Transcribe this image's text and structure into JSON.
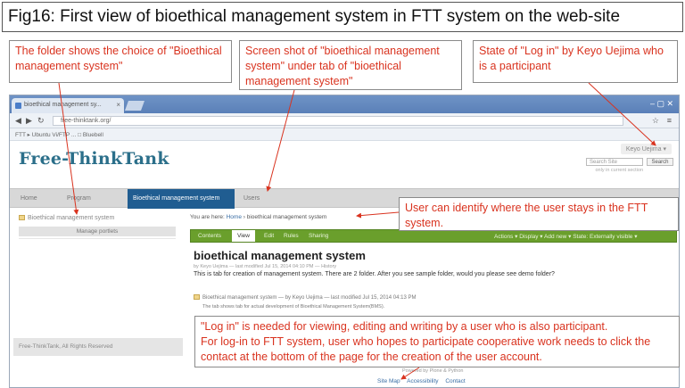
{
  "figure": {
    "title": "Fig16: First view of bioethical management system in FTT system on the web-site"
  },
  "callouts": {
    "folder_choice": "The folder shows the choice of \"Bioethical management system\"",
    "screenshot_note": "Screen shot of \"bioethical management system\" under tab of \"bioethical management system\"",
    "login_state": "State of \"Log in\"  by Keyo Uejima who is a participant",
    "identify_location": "User can identify where the user stays in the FTT system.",
    "login_needed": "\"Log in\" is needed for viewing, editing and writing by a user who is also  participant.\nFor log-in to FTT system, user who hopes to participate  cooperative work needs to click the contact at the bottom of the page for the creation of the user account."
  },
  "browser": {
    "tab_title": "bioethical management sy...",
    "tab_close": "×",
    "url": "free-thinktank.org/",
    "bookmarks": "FTT  ▸ Ubuntu Vi/FTP ... □ Bluebell",
    "window_controls": "– ▢ ✕"
  },
  "site": {
    "login_user": "Keyo Uejima ▾",
    "logo": "Free-ThinkTank",
    "search_placeholder": "Search Site",
    "search_button": "Search",
    "search_hint": "only in current section",
    "nav": [
      "Home",
      "Program",
      "Bioethical management system",
      "Users"
    ],
    "sidebar_link": "Bioethical management system",
    "manage_portlets": "Manage portlets",
    "footer_left": "Free-ThinkTank, All Rights Reserved",
    "breadcrumb_prefix": "You are here:",
    "breadcrumb_home": "Home",
    "breadcrumb_sep": " › ",
    "breadcrumb_current": "bioethical management system",
    "toolbar": [
      "Contents",
      "View",
      "Edit",
      "Rules",
      "Sharing"
    ],
    "toolbar_right": "Actions ▾   Display ▾   Add new ▾   State: Externally visible ▾",
    "content_title": "bioethical management system",
    "meta": "by Keyo Uejima — last modified Jul 15, 2014 04:10 PM — History",
    "description": "This is tab for creation of management system. There are 2 folder. After you see sample folder, would you please see demo folder?",
    "item_line": "Bioethical management system — by Keyo Uejima — last modified Jul 15, 2014 04:13 PM",
    "item_desc": "The tab shows tab for actual development of Bioethical Management System(BMS).",
    "powered_by": "Powered by Plone & Python",
    "footer_links": [
      "Site Map",
      "Accessibility",
      "Contact"
    ]
  }
}
